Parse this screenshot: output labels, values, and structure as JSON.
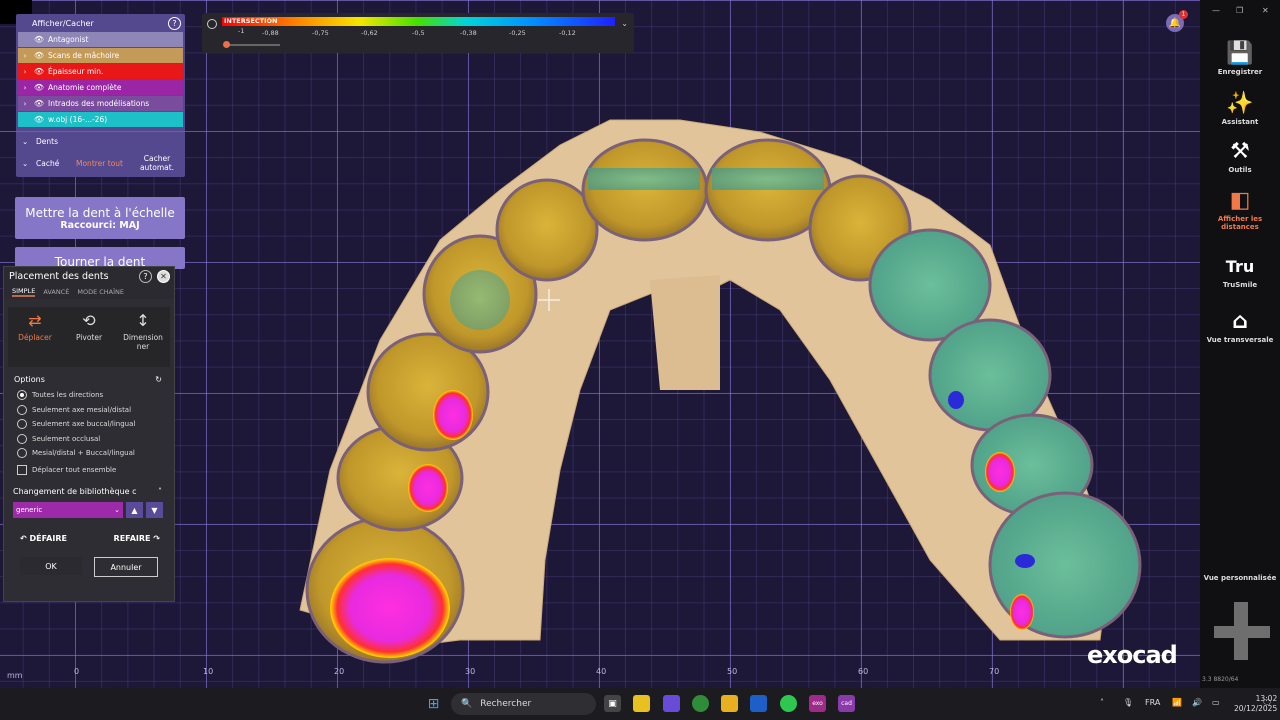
{
  "layers_panel": {
    "title": "Afficher/Cacher",
    "items": [
      {
        "label": "Antagonist",
        "color": "#8d86b6",
        "expandable": false
      },
      {
        "label": "Scans de mâchoire",
        "color": "#c49a58",
        "expandable": true
      },
      {
        "label": "Épaisseur min.",
        "color": "#e81818",
        "expandable": true
      },
      {
        "label": "Anatomie complète",
        "color": "#9a26a6",
        "expandable": true
      },
      {
        "label": "Intrados des modélisations",
        "color": "#9c52a4",
        "expandable": true
      },
      {
        "label": "w.obj (16-...-26)",
        "color": "#1ec0c8",
        "expandable": false
      }
    ],
    "dents_label": "Dents",
    "cache_label": "Caché",
    "montrer_tout": "Montrer tout",
    "cacher_automat": "Cacher automat."
  },
  "scale_button": {
    "line1": "Mettre la dent à l'échelle",
    "line2": "Raccourci: MAJ"
  },
  "rotate_button": {
    "line1": "Tourner la dent"
  },
  "placement_dialog": {
    "title": "Placement des dents",
    "tabs": [
      "SIMPLE",
      "AVANCÉ",
      "MODE CHAÎNE"
    ],
    "tools": [
      {
        "label": "Déplacer",
        "icon": "move-arrows-icon"
      },
      {
        "label": "Pivoter",
        "icon": "rotate-icon"
      },
      {
        "label": "Dimension ner",
        "icon": "resize-vertical-icon"
      }
    ],
    "options_title": "Options",
    "options": [
      {
        "label": "Toutes les directions",
        "checked": true
      },
      {
        "label": "Seulement axe mesial/distal",
        "checked": false
      },
      {
        "label": "Seulement axe buccal/lingual",
        "checked": false
      },
      {
        "label": "Seulement occlusal",
        "checked": false
      },
      {
        "label": "Mesial/distal + Buccal/lingual",
        "checked": false
      }
    ],
    "move_all_label": "Déplacer tout ensemble",
    "library_title": "Changement de bibliothèque c",
    "library_value": "generic",
    "undo_label": "DÉFAIRE",
    "redo_label": "REFAIRE",
    "ok_label": "OK",
    "cancel_label": "Annuler"
  },
  "color_scale": {
    "title": "INTERSECTION",
    "ticks": [
      "-1",
      "-0,88",
      "-0,75",
      "-0,62",
      "-0,5",
      "-0,38",
      "-0,25",
      "-0,12"
    ],
    "slider_value": 0.05
  },
  "ruler": {
    "unit": "mm",
    "ticks": [
      "0",
      "10",
      "20",
      "30",
      "40",
      "50",
      "60",
      "70"
    ]
  },
  "right_toolbar": {
    "items": [
      {
        "label": "Enregistrer",
        "icon": "save-icon"
      },
      {
        "label": "Assistant",
        "icon": "wand-icon"
      },
      {
        "label": "Outils",
        "icon": "tools-icon"
      },
      {
        "label": "Afficher les distances",
        "icon": "distances-icon",
        "active": true
      },
      {
        "label": "TruSmile",
        "icon": "trusmile-icon"
      },
      {
        "label": "Vue transversale",
        "icon": "cross-section-icon"
      }
    ],
    "custom_view_label": "Vue personnalisée"
  },
  "notifications": {
    "count": "1"
  },
  "brand": {
    "logo_text": "exocad",
    "version": "3.3 8820/64"
  },
  "taskbar": {
    "search_placeholder": "Rechercher",
    "language": "FRA",
    "time": "13:02",
    "date": "20/12/2025"
  },
  "colors": {
    "accent": "#f07a47",
    "panel": "#54488f",
    "button": "#8676c7",
    "grid": "#8c78dc"
  }
}
